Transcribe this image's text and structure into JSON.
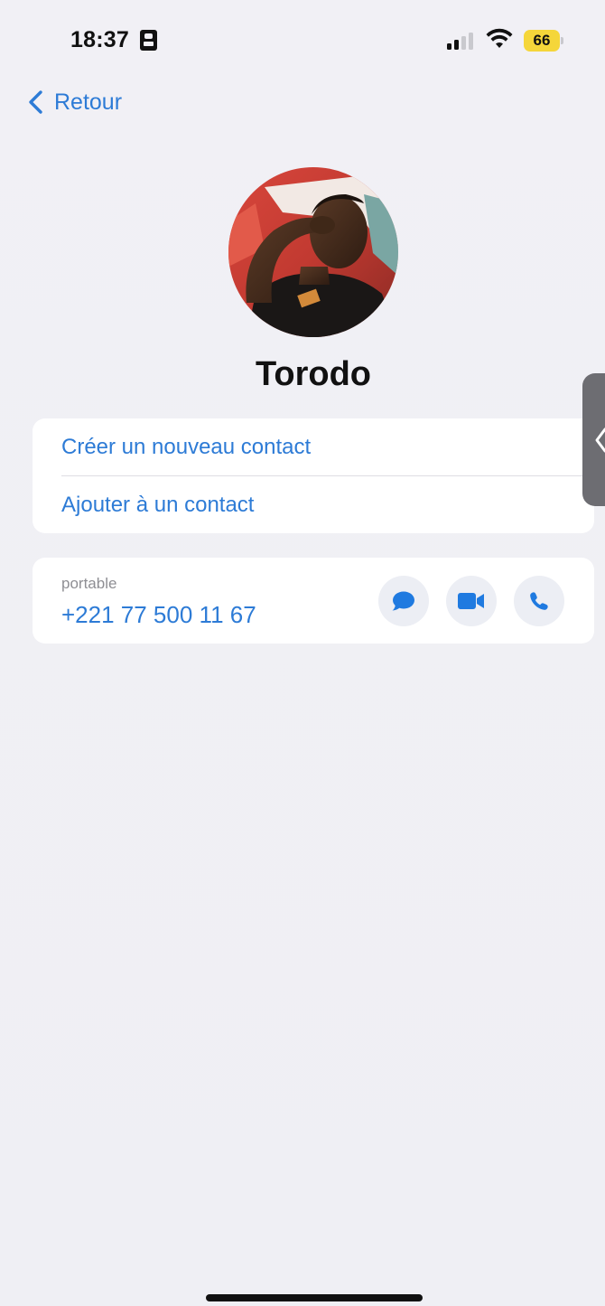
{
  "status_bar": {
    "time": "18:37",
    "battery_level": "66",
    "battery_color": "#f5d63a",
    "signal_icon": "cellular-signal-icon",
    "wifi_icon": "wifi-icon"
  },
  "nav": {
    "back_label": "Retour",
    "back_icon": "chevron-left-icon"
  },
  "contact": {
    "name": "Torodo",
    "avatar": "contact-photo"
  },
  "actions": {
    "create_contact": "Créer un nouveau contact",
    "add_to_contact": "Ajouter à un contact"
  },
  "phone": {
    "label": "portable",
    "number": "+221 77 500 11 67",
    "buttons": [
      "message-icon",
      "video-icon",
      "phone-icon"
    ]
  },
  "colors": {
    "accent": "#2d7bd6",
    "background": "#f0eff6",
    "card": "#ffffff",
    "button_bg": "#eceef4"
  }
}
